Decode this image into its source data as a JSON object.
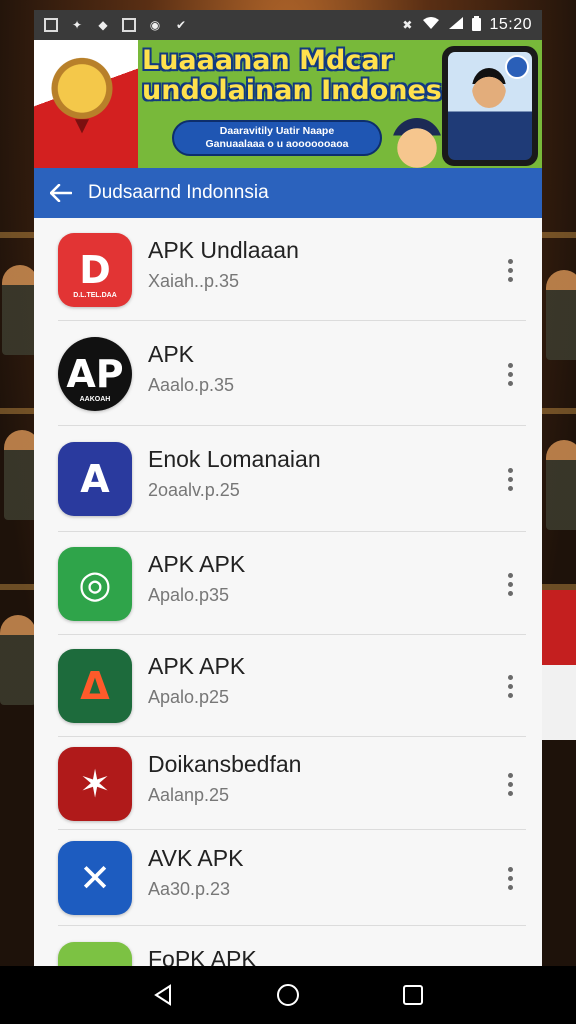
{
  "status_bar": {
    "time": "15:20",
    "left_icons": [
      "image-icon",
      "flame-icon",
      "puzzle-icon",
      "sim-icon",
      "camera-icon",
      "check-icon"
    ],
    "right_icons": [
      "mute-icon",
      "wifi-icon",
      "signal-icon",
      "battery-icon"
    ]
  },
  "banner": {
    "headline_line1": "Luaaanan Mdcar",
    "headline_line2": "undolainan Indonesia",
    "pill_line1": "Daaravitily Uatir Naape",
    "pill_line2": "Ganuaalaaa o u aooooooaoa"
  },
  "appbar": {
    "title": "Dudsaarnd Indonnsia"
  },
  "apps": [
    {
      "name": "APK Undlaaan",
      "sub": "Xaiah..p.35",
      "icon": "d-logo-icon",
      "bg": "#e23434",
      "fg": "#ffffff",
      "glyph": "D",
      "caption": "D.L.TEL.DAA"
    },
    {
      "name": "APK",
      "sub": "Aaalo.p.35",
      "icon": "ap-logo-icon",
      "bg": "#111111",
      "fg": "#ffffff",
      "glyph": "AP",
      "caption": "AAKOAH"
    },
    {
      "name": "Enok Lomanaian",
      "sub": "2oaalv.p.25",
      "icon": "triangle-logo-icon",
      "bg": "#2a3a9e",
      "fg": "#ffffff",
      "glyph": "A",
      "caption": ""
    },
    {
      "name": "APK APK",
      "sub": "Apalo.p35",
      "icon": "circle-logo-icon",
      "bg": "#2fa44a",
      "fg": "#ffffff",
      "glyph": "◎",
      "caption": ""
    },
    {
      "name": "APK APK",
      "sub": "Apalo.p25",
      "icon": "delta-logo-icon",
      "bg": "#1d6b3c",
      "fg": "#ff5a2a",
      "glyph": "Δ",
      "caption": ""
    },
    {
      "name": "Doikansbedfan",
      "sub": "Aalanp.25",
      "icon": "emblem-logo-icon",
      "bg": "#b01a1a",
      "fg": "#ffffff",
      "glyph": "✶",
      "caption": ""
    },
    {
      "name": "AVK APK",
      "sub": "Aa30.p.23",
      "icon": "compass-logo-icon",
      "bg": "#1d5cc0",
      "fg": "#ffffff",
      "glyph": "✕",
      "caption": ""
    },
    {
      "name": "FoPK APK",
      "sub": "",
      "icon": "shield-logo-icon",
      "bg": "#7cc243",
      "fg": "#e0462c",
      "glyph": "▼",
      "caption": ""
    }
  ],
  "nav": {
    "back": "back-nav-icon",
    "home": "home-nav-icon",
    "recents": "recents-nav-icon"
  }
}
